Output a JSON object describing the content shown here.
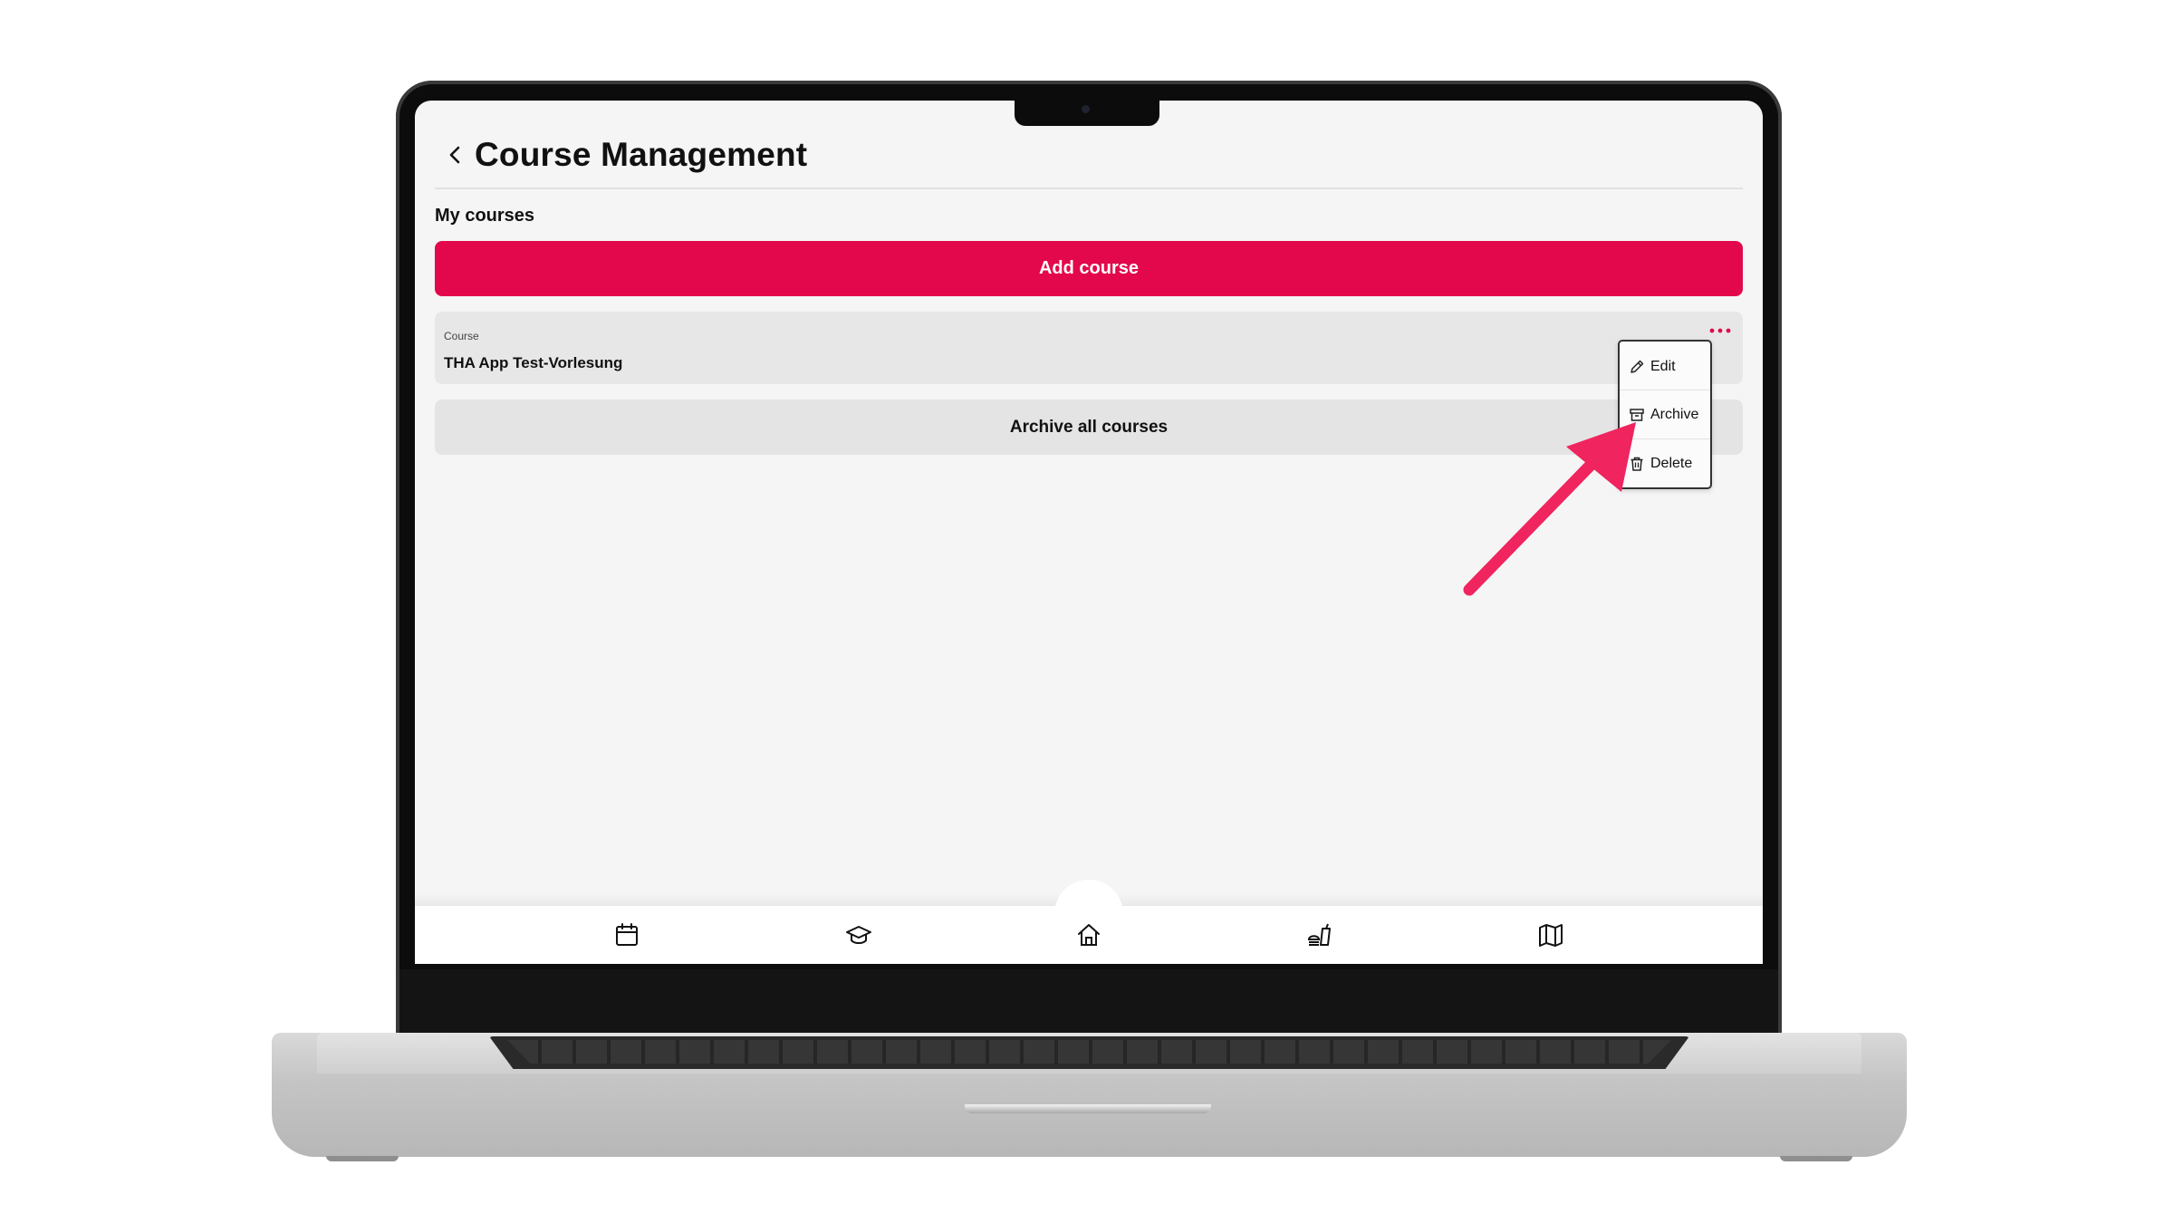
{
  "header": {
    "title": "Course Management"
  },
  "section": {
    "label": "My courses"
  },
  "actions": {
    "add_course": "Add course",
    "archive_all": "Archive all courses"
  },
  "course": {
    "caption": "Course",
    "name": "THA App Test-Vorlesung"
  },
  "context_menu": {
    "items": [
      {
        "label": "Edit",
        "icon": "pencil-icon"
      },
      {
        "label": "Archive",
        "icon": "archive-box-icon"
      },
      {
        "label": "Delete",
        "icon": "trash-icon"
      }
    ]
  },
  "bottom_nav": {
    "items": [
      {
        "icon": "calendar-icon"
      },
      {
        "icon": "graduation-cap-icon"
      },
      {
        "icon": "home-icon"
      },
      {
        "icon": "cafeteria-icon"
      },
      {
        "icon": "map-icon"
      }
    ]
  },
  "colors": {
    "accent": "#e3084b",
    "annotation_arrow": "#f0245e"
  }
}
